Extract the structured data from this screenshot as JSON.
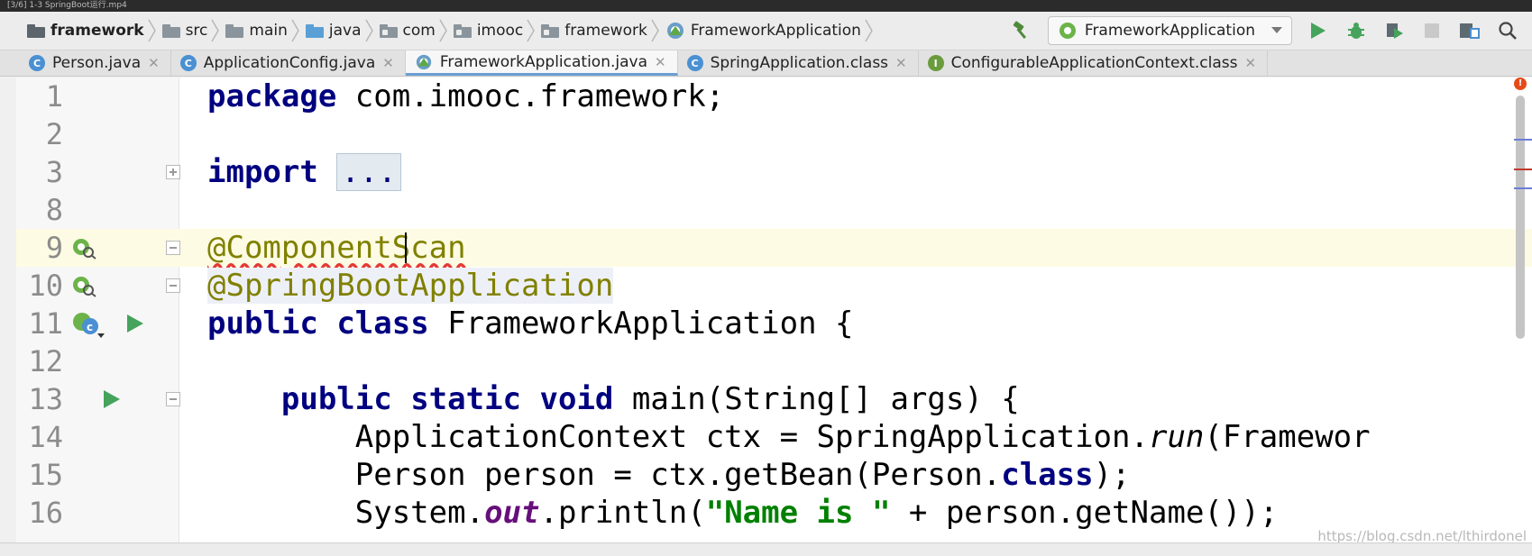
{
  "window": {
    "title": "[3/6] 1-3 SpringBoot运行.mp4"
  },
  "breadcrumb": [
    {
      "label": "framework",
      "icon": "folder-dark-icon"
    },
    {
      "label": "src",
      "icon": "folder-icon"
    },
    {
      "label": "main",
      "icon": "folder-icon"
    },
    {
      "label": "java",
      "icon": "source-folder-icon"
    },
    {
      "label": "com",
      "icon": "package-icon"
    },
    {
      "label": "imooc",
      "icon": "package-icon"
    },
    {
      "label": "framework",
      "icon": "package-icon"
    },
    {
      "label": "FrameworkApplication",
      "icon": "spring-class-icon"
    }
  ],
  "toolbar": {
    "run_config": "FrameworkApplication",
    "icons": [
      "build-hammer-icon",
      "run-icon",
      "debug-icon",
      "coverage-icon",
      "stop-icon",
      "project-structure-icon",
      "search-icon"
    ]
  },
  "tabs": [
    {
      "label": "Person.java",
      "icon": "C",
      "active": false
    },
    {
      "label": "ApplicationConfig.java",
      "icon": "C",
      "active": false
    },
    {
      "label": "FrameworkApplication.java",
      "icon": "spring",
      "active": true
    },
    {
      "label": "SpringApplication.class",
      "icon": "C",
      "active": false
    },
    {
      "label": "ConfigurableApplicationContext.class",
      "icon": "I",
      "active": false
    }
  ],
  "editor": {
    "lines": [
      {
        "n": "1",
        "text": "package com.imooc.framework;"
      },
      {
        "n": "2",
        "text": ""
      },
      {
        "n": "3",
        "text": "import ..."
      },
      {
        "n": "8",
        "text": ""
      },
      {
        "n": "9",
        "text": "@ComponentScan"
      },
      {
        "n": "10",
        "text": "@SpringBootApplication"
      },
      {
        "n": "11",
        "text": "public class FrameworkApplication {"
      },
      {
        "n": "12",
        "text": ""
      },
      {
        "n": "13",
        "text": "    public static void main(String[] args) {"
      },
      {
        "n": "14",
        "text": "        ApplicationContext ctx = SpringApplication.run(Framewor"
      },
      {
        "n": "15",
        "text": "        Person person = ctx.getBean(Person.class);"
      },
      {
        "n": "16",
        "text": "        System.out.println(\"Name is \" + person.getName());"
      }
    ]
  },
  "tokens": {
    "l1": [
      "package",
      " com.imooc.framework;"
    ],
    "l3": [
      "import",
      "..."
    ],
    "l9": [
      "@ComponentScan"
    ],
    "l10": [
      "@SpringBootApplication"
    ],
    "l11": [
      "public",
      "class",
      " FrameworkApplication {"
    ],
    "l13": [
      "public",
      "static",
      "void",
      " main(String[] args) {"
    ],
    "l14": [
      "ApplicationContext ctx = SpringApplication.",
      "run",
      "(Framewor"
    ],
    "l15": [
      "Person person = ctx.getBean(Person.",
      "class",
      ");"
    ],
    "l16": [
      "System.",
      "out",
      ".println(",
      "\"Name is \"",
      " + person.getName());"
    ]
  },
  "watermark": "https://blog.csdn.net/lthirdonel",
  "colors": {
    "keyword": "#000080",
    "annotation": "#808000",
    "string": "#008000",
    "static_field": "#660e7a",
    "run_green": "#45a35b"
  }
}
